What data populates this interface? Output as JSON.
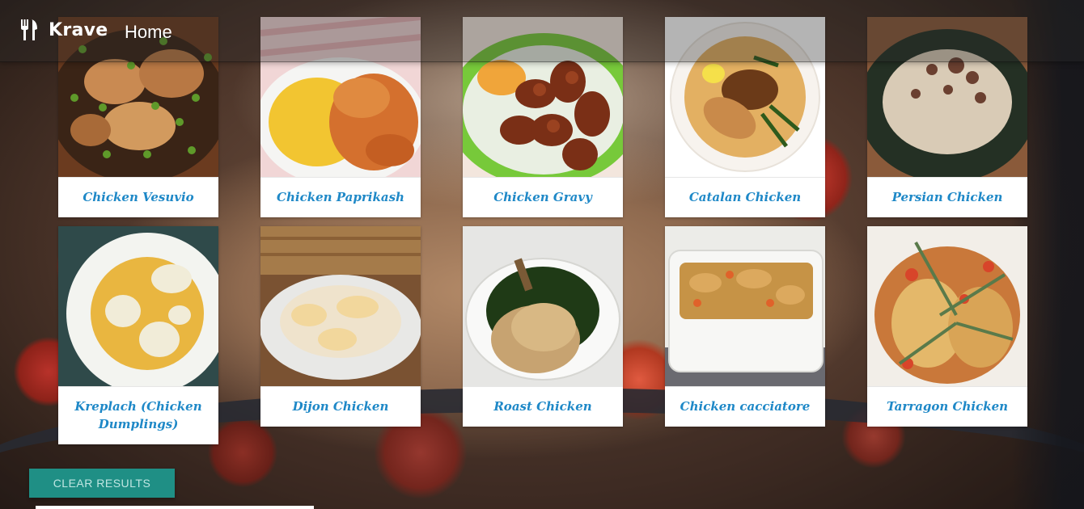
{
  "app": {
    "brand": "Krave",
    "nav_home": "Home",
    "logo_icon": "fork-knife-icon"
  },
  "recipes": [
    {
      "title": "Chicken Vesuvio",
      "image": "chicken-vesuvio-photo"
    },
    {
      "title": "Chicken Paprikash",
      "image": "chicken-paprikash-photo"
    },
    {
      "title": "Chicken Gravy",
      "image": "chicken-gravy-photo"
    },
    {
      "title": "Catalan Chicken",
      "image": "catalan-chicken-photo"
    },
    {
      "title": "Persian Chicken",
      "image": "persian-chicken-photo"
    },
    {
      "title": "Kreplach (Chicken Dumplings)",
      "image": "kreplach-photo"
    },
    {
      "title": "Dijon Chicken",
      "image": "dijon-chicken-photo"
    },
    {
      "title": "Roast Chicken",
      "image": "roast-chicken-photo"
    },
    {
      "title": "Chicken cacciatore",
      "image": "chicken-cacciatore-photo"
    },
    {
      "title": "Tarragon Chicken",
      "image": "tarragon-chicken-photo"
    }
  ],
  "actions": {
    "clear_results": "CLEAR RESULTS"
  },
  "colors": {
    "title_text": "#1e88c7",
    "button_bg": "#1f8f85"
  }
}
